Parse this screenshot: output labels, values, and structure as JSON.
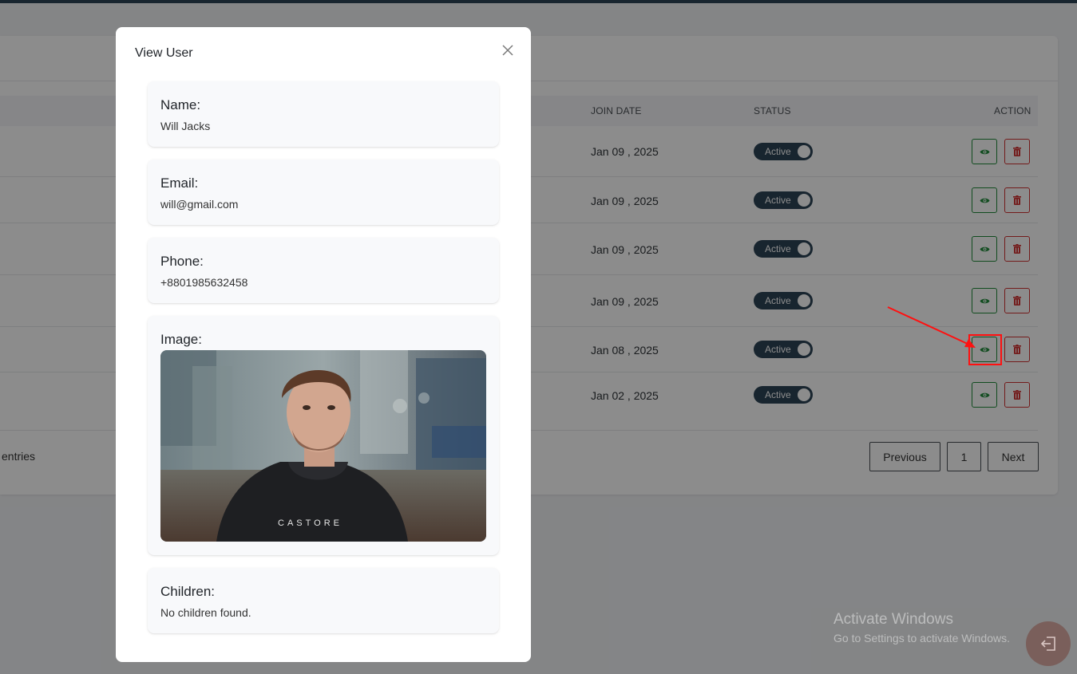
{
  "table": {
    "headers": {
      "join_date": "JOIN DATE",
      "status": "STATUS",
      "action": "ACTION"
    },
    "rows": [
      {
        "join_date": "Jan 09 , 2025",
        "status": "Active"
      },
      {
        "join_date": "Jan 09 , 2025",
        "status": "Active"
      },
      {
        "join_date": "Jan 09 , 2025",
        "status": "Active"
      },
      {
        "join_date": "Jan 09 , 2025",
        "status": "Active"
      },
      {
        "join_date": "Jan 08 , 2025",
        "status": "Active"
      },
      {
        "join_date": "Jan 02 , 2025",
        "status": "Active"
      }
    ],
    "entries_text": "entries"
  },
  "pagination": {
    "previous": "Previous",
    "current_page": "1",
    "next": "Next"
  },
  "modal": {
    "title": "View User",
    "fields": {
      "name": {
        "label": "Name:",
        "value": "Will Jacks"
      },
      "email": {
        "label": "Email:",
        "value": "will@gmail.com"
      },
      "phone": {
        "label": "Phone:",
        "value": "+8801985632458"
      },
      "image": {
        "label": "Image:",
        "hoodie_text": "CASTORE"
      },
      "children": {
        "label": "Children:",
        "value": "No children found."
      }
    }
  },
  "watermark": {
    "line1": "Activate Windows",
    "line2": "Go to Settings to activate Windows."
  },
  "colors": {
    "accent_dark": "#2d4456",
    "view_green": "#1f8a3a",
    "delete_red": "#d13232",
    "annotation_red": "#ff1010"
  },
  "icons": {
    "view": "eye-icon",
    "delete": "trash-icon",
    "close": "close-icon",
    "logout": "logout-icon"
  }
}
